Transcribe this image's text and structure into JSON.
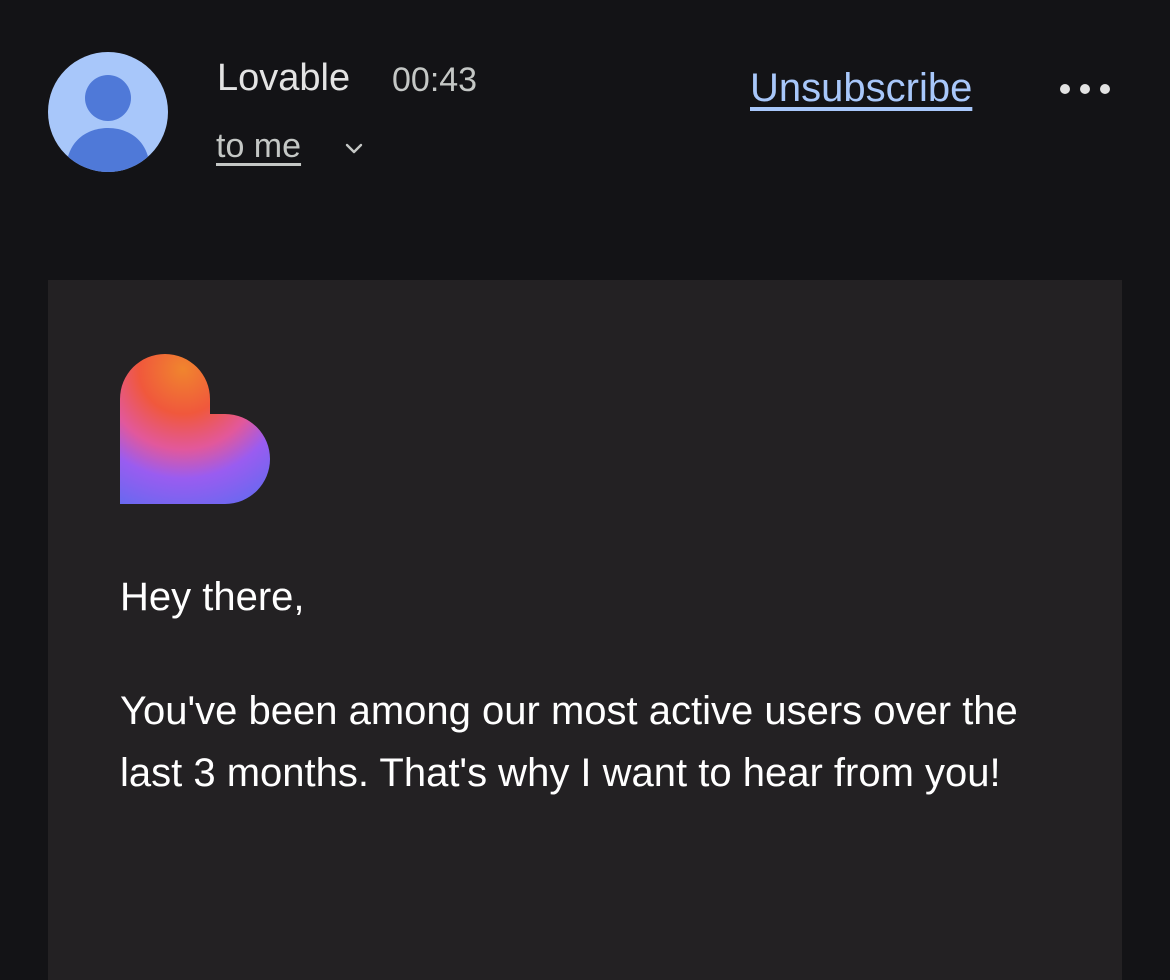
{
  "header": {
    "sender_name": "Lovable",
    "time": "00:43",
    "recipient_label": "to me",
    "unsubscribe_label": "Unsubscribe",
    "avatar_icon": "person-icon",
    "recipient_expand_icon": "chevron-down-icon",
    "more_icon": "more-horizontal-icon"
  },
  "email": {
    "logo_icon": "lovable-heart-logo",
    "greeting": "Hey there,",
    "paragraph": "You've been among our most active users over the last 3 months. That's why I want to hear from you!"
  },
  "colors": {
    "background": "#131316",
    "card": "#232123",
    "link": "#a8c7fa",
    "avatar_bg": "#a8c7fa",
    "avatar_figure": "#4f79d8"
  }
}
